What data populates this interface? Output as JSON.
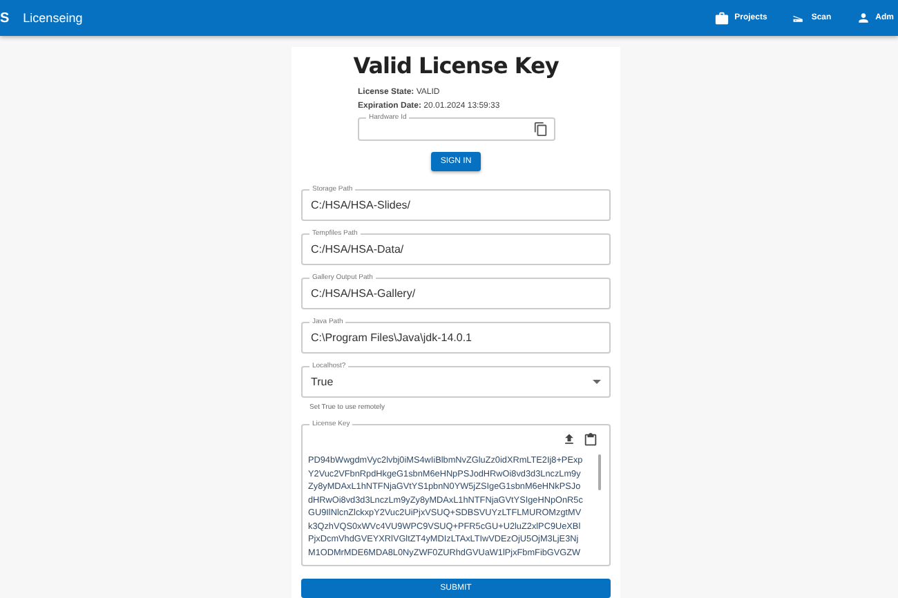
{
  "app_bar": {
    "logo": "S",
    "title": "Licenseing",
    "actions": [
      {
        "label": "Projects"
      },
      {
        "label": "Scan"
      },
      {
        "label": "Adm"
      }
    ]
  },
  "heading": "Valid License Key",
  "info": [
    {
      "label": "License State:",
      "value": "VALID"
    },
    {
      "label": "Expiration Date:",
      "value": "20.01.2024 13:59:33"
    }
  ],
  "hardware_id": {
    "label": "Hardware Id"
  },
  "sign_in_button": "SIGN IN",
  "fields": [
    {
      "kind": "text",
      "label": "Storage Path",
      "value": "C:/HSA/HSA-Slides/"
    },
    {
      "kind": "text",
      "label": "Tempfiles Path",
      "value": "C:/HSA/HSA-Data/"
    },
    {
      "kind": "text",
      "label": "Gallery Output Path",
      "value": "C:/HSA/HSA-Gallery/"
    },
    {
      "kind": "text",
      "label": "Java Path",
      "value": "C:\\Program Files\\Java\\jdk-14.0.1"
    },
    {
      "kind": "select",
      "label": "Localhost?",
      "value": "True",
      "helper": "Set True to use remotely"
    }
  ],
  "license_key": {
    "label": "License Key",
    "lines": [
      "PD94bWwgdmVyc2lvbj0iMS4wIiBlbmNvZGluZz0idXRmLTE2Ij8+PExp",
      "Y2Vuc2VFbnRpdHkgeG1sbnM6eHNpPSJodHRwOi8vd3d3LnczLm9y",
      "Zy8yMDAxL1hNTFNjaGVtYS1pbnN0YW5jZSIgeG1sbnM6eHNkPSJo",
      "dHRwOi8vd3d3LnczLm9yZy8yMDAxL1hNTFNjaGVtYSIgeHNpOnR5c",
      "GU9IlNlcnZlckxpY2Vuc2UiPjxVSUQ+SDBSVUYzLTFLMUROMzgtMV",
      "k3QzhVQS0xWVc4VU9WPC9VSUQ+PFR5cGU+U2luZ2xlPC9UeXBl",
      "PjxDcmVhdGVEYXRlVGltZT4yMDIzLTAxLTIwVDEzOjU5OjM3LjE3Nj",
      "M1ODMrMDE6MDA8L0NyZWF0ZURhdGVUaW1lPjxFbmFibGVGZW"
    ]
  },
  "submit_button": "SUBMIT"
}
